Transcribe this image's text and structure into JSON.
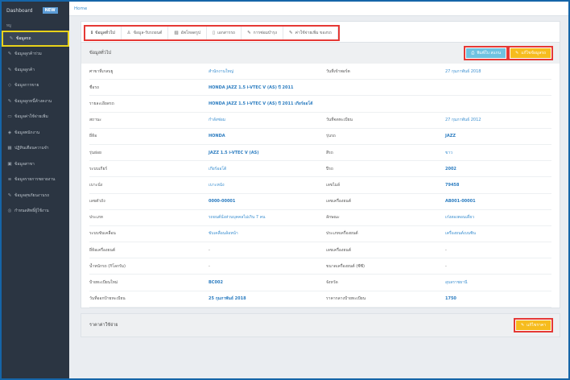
{
  "sidebar": {
    "top_label": "Dashboard",
    "badge": "NEW",
    "section": "หมู",
    "items": [
      {
        "label": "ข้อมูลรถ",
        "icon": "wrench-icon",
        "glyph": "✎",
        "active": true
      },
      {
        "label": "ข้อมูลลูกค้าร่วม",
        "icon": "wrench-icon",
        "glyph": "✎"
      },
      {
        "label": "ข้อมูลลูกค้า",
        "icon": "wrench-icon",
        "glyph": "✎"
      },
      {
        "label": "ข้อมูลการขาย",
        "icon": "diamond-icon",
        "glyph": "◇"
      },
      {
        "label": "ข้อมูลลูกหนี้ค้างคงาน",
        "icon": "wrench-icon",
        "glyph": "✎"
      },
      {
        "label": "ข้อมูลค่าใช้จ่ายเพิ่ม",
        "icon": "folder-icon",
        "glyph": "▭"
      },
      {
        "label": "ข้อมูลพนักงาน",
        "icon": "tag-icon",
        "glyph": "◈"
      },
      {
        "label": "ปฏิทินเตือนความจำ",
        "icon": "calendar-icon",
        "glyph": "▦"
      },
      {
        "label": "ข้อมูลสาขา",
        "icon": "grid-icon",
        "glyph": "▣"
      },
      {
        "label": "ข้อมูลรายการขยายงาน",
        "icon": "list-icon",
        "glyph": "≡"
      },
      {
        "label": "ข้อมูลสุขภัยนงานรถ",
        "icon": "wrench-icon",
        "glyph": "✎"
      },
      {
        "label": "กำหนดสิทธิ์ผู้ใช้งาน",
        "icon": "globe-icon",
        "glyph": "◎"
      }
    ]
  },
  "topbar": {
    "home": "Home"
  },
  "tabs": [
    {
      "label": "ข้อมูลทั่วไป",
      "icon": "info-icon",
      "glyph": "ℹ",
      "active": true
    },
    {
      "label": "ข้อมูล-รับรถยนต์",
      "icon": "user-icon",
      "glyph": "♙"
    },
    {
      "label": "อัพโหลดรูป",
      "icon": "image-icon",
      "glyph": "▨"
    },
    {
      "label": "เอกสารรถ",
      "icon": "file-icon",
      "glyph": "▯"
    },
    {
      "label": "การซ่อมบำรุง",
      "icon": "wrench-icon",
      "glyph": "✎"
    },
    {
      "label": "ค่าใช้จ่ายเพิ่ม ของรถ",
      "icon": "wrench-icon",
      "glyph": "✎"
    }
  ],
  "general": {
    "title": "ข้อมูลทั่วไป",
    "btn_print": "พิมพ์ใบ สแกน",
    "btn_edit": "แก้ไขข้อมูลรถ",
    "rows": [
      {
        "l1": "ศาขาที่เกลบยู",
        "v1": "สำนักงานใหญ่",
        "s1": false,
        "l2": "วันที่เข้าพอร์ต",
        "v2": "27 กุมภาพันธ์ 2018",
        "s2": false
      },
      {
        "l1": "ชื่อรถ",
        "v1": "HONDA JAZZ 1.5 i-VTEC V (AS) ปี 2011",
        "s1": true,
        "l2": "",
        "v2": "",
        "s2": false
      },
      {
        "l1": "รายละเอียดรถ",
        "v1": "HONDA JAZZ 1.5 i-VTEC V (AS) ปี 2011 เกียร์ออโต้",
        "s1": true,
        "l2": "",
        "v2": "",
        "s2": false
      },
      {
        "l1": "สถานะ",
        "v1": "กำลังซ่อม",
        "s1": false,
        "l2": "วันที่จดทะเบียน",
        "v2": "27 กุมภาพันธ์ 2012",
        "s2": false
      },
      {
        "l1": "ยี่ห้อ",
        "v1": "HONDA",
        "s1": true,
        "l2": "รุ่นรถ",
        "v2": "JAZZ",
        "s2": true
      },
      {
        "l1": "รุ่นย่อย",
        "v1": "JAZZ 1.5 i-VTEC V (AS)",
        "s1": true,
        "l2": "สีรถ",
        "v2": "ขาว",
        "s2": false
      },
      {
        "l1": "ระบบเกียร์",
        "v1": "เกียร์ออโต้",
        "s1": false,
        "l2": "ปีรถ",
        "v2": "2002",
        "s2": true
      },
      {
        "l1": "เบาะนั่ง",
        "v1": "เบาะหนัง",
        "s1": false,
        "l2": "เลขไมล์",
        "v2": "79458",
        "s2": true
      },
      {
        "l1": "เลขตัวถัง",
        "v1": "0000-00001",
        "s1": true,
        "l2": "เลขเครื่องยนต์",
        "v2": "AB001-00001",
        "s2": true
      },
      {
        "l1": "ประเภท",
        "v1": "รถยนต์นั่งส่วนบุคคลไม่เกิน 7 คน",
        "s1": false,
        "l2": "ลักษณะ",
        "v2": "เก๋งสองตอนเดี่ยว",
        "s2": false
      },
      {
        "l1": "ระบบขับเคลื่อน",
        "v1": "ขับเคลื่อนล้อหน้า",
        "s1": false,
        "l2": "ประเภทเครื่องยนต์",
        "v2": "เครื่องยนต์เบนซิน",
        "s2": false
      },
      {
        "l1": "ยี่ห้อเครื่องยนต์",
        "v1": "-",
        "s1": false,
        "l2": "เลขเครื่องยนต์",
        "v2": "-",
        "s2": false
      },
      {
        "l1": "น้ำหนักรถ (กิโลกรัม)",
        "v1": "-",
        "s1": false,
        "l2": "ขนาดเครื่องยนต์ (ซีซี)",
        "v2": "-",
        "s2": false
      },
      {
        "l1": "ป้ายทะเบียนใหม่",
        "v1": "BC002",
        "s1": true,
        "l2": "จังหวัด",
        "v2": "อุบลราชธานี",
        "s2": false
      },
      {
        "l1": "วันที่ออกป้ายทะเบียน",
        "v1": "25 กุมภาพันธ์ 2018",
        "s1": true,
        "l2": "ราคากลางป้ายทะเบียน",
        "v2": "1750",
        "s2": true
      }
    ]
  },
  "expenses": {
    "title": "ราคาค่าใช้จ่าย",
    "btn_edit": "แก้ไขราคา"
  },
  "colors": {
    "sidebar": "#2b3542",
    "accent": "#3b8fd0",
    "highlight": "#e53935",
    "yellow": "#f6bc1e",
    "cyan": "#6fc2e0"
  }
}
